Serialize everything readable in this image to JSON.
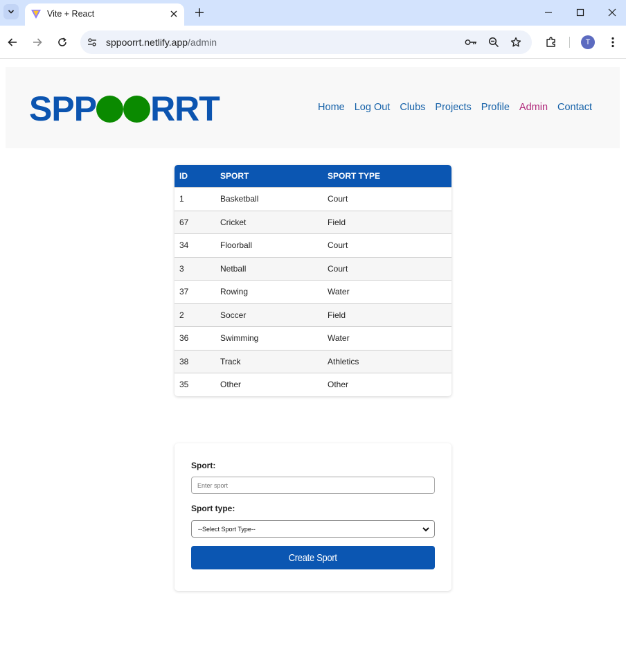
{
  "browser": {
    "tab_title": "Vite + React",
    "url_host": "sppoorrt.netlify.app",
    "url_path": "/admin",
    "profile_initial": "T"
  },
  "site": {
    "logo_left": "SPP",
    "logo_right": "RRT",
    "logo_color": "#0b54b0",
    "logo_dot_color": "#0a8a00",
    "nav": [
      {
        "label": "Home"
      },
      {
        "label": "Log Out"
      },
      {
        "label": "Clubs"
      },
      {
        "label": "Projects"
      },
      {
        "label": "Profile"
      },
      {
        "label": "Admin",
        "active": true
      },
      {
        "label": "Contact"
      }
    ]
  },
  "table": {
    "headers": [
      "ID",
      "SPORT",
      "SPORT TYPE"
    ],
    "rows": [
      {
        "id": "1",
        "sport": "Basketball",
        "type": "Court"
      },
      {
        "id": "67",
        "sport": "Cricket",
        "type": "Field"
      },
      {
        "id": "34",
        "sport": "Floorball",
        "type": "Court"
      },
      {
        "id": "3",
        "sport": "Netball",
        "type": "Court"
      },
      {
        "id": "37",
        "sport": "Rowing",
        "type": "Water"
      },
      {
        "id": "2",
        "sport": "Soccer",
        "type": "Field"
      },
      {
        "id": "36",
        "sport": "Swimming",
        "type": "Water"
      },
      {
        "id": "38",
        "sport": "Track",
        "type": "Athletics"
      },
      {
        "id": "35",
        "sport": "Other",
        "type": "Other"
      }
    ]
  },
  "form": {
    "sport_label": "Sport:",
    "sport_placeholder": "Enter sport",
    "type_label": "Sport type:",
    "type_selected": "--Select Sport Type--",
    "submit_label": "Create Sport"
  }
}
